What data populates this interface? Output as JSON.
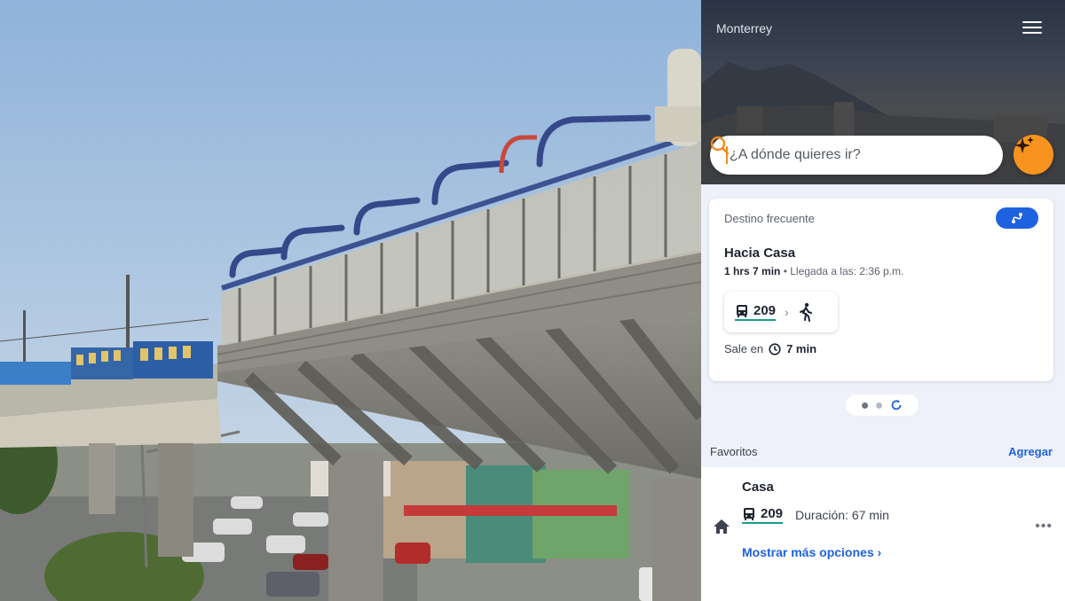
{
  "header": {
    "city": "Monterrey",
    "menu_icon": "hamburger-menu-icon"
  },
  "search": {
    "placeholder": "¿A dónde quieres ir?",
    "search_icon": "search-icon",
    "ai_button_icon": "sparkle-icon"
  },
  "frequent": {
    "label": "Destino frecuente",
    "route_icon": "route-icon",
    "title": "Hacia Casa",
    "duration": "1 hrs 7 min",
    "arrival": "• Llegada a las: 2:36 p.m.",
    "bus_route": "209",
    "walk_icon": "walk-icon",
    "leaves_label": "Sale en",
    "leaves_value": "7 min"
  },
  "favorites": {
    "header": "Favoritos",
    "add_label": "Agregar",
    "items": [
      {
        "name": "Casa",
        "bus_route": "209",
        "duration": "Duración: 67 min",
        "more_options": "Mostrar más opciones",
        "more_icon": "more-dots-icon",
        "icon": "home-icon"
      }
    ]
  },
  "colors": {
    "accent_blue": "#1f62e0",
    "accent_orange": "#f7931e",
    "route_underline": "#1a9c8c"
  }
}
